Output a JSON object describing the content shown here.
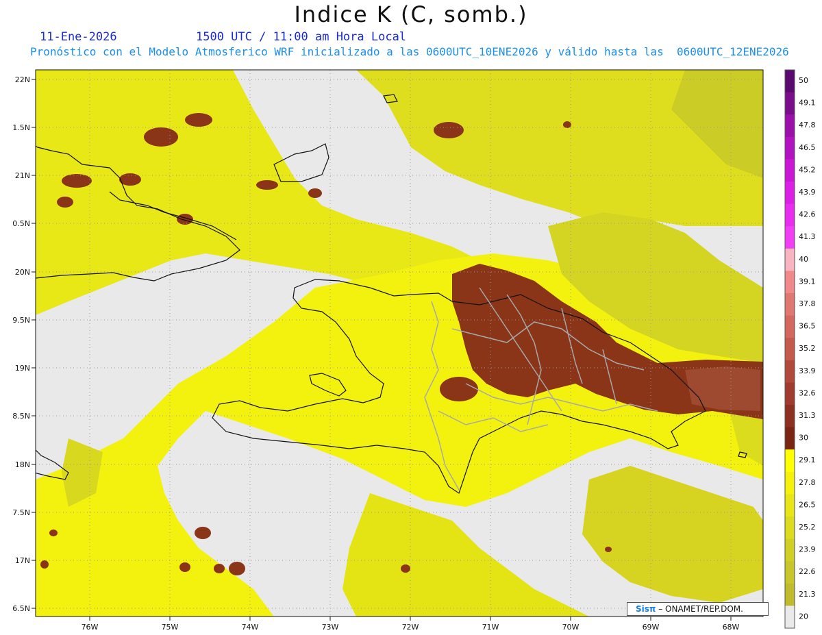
{
  "title": "Indice K (C, somb.)",
  "date": "11-Ene-2026",
  "time_text": "1500 UTC / 11:00 am Hora Local",
  "forecast_text": "Pronóstico con el Modelo Atmosferico WRF inicializado a las 0600UTC_10ENE2026 y válido hasta las  0600UTC_12ENE2026",
  "credit": {
    "logo": "Sisπ",
    "text": "– ONAMET/REP.DOM."
  },
  "lat_labels": [
    "22N",
    "1.5N",
    "21N",
    "0.5N",
    "20N",
    "9.5N",
    "19N",
    "8.5N",
    "18N",
    "7.5N",
    "17N",
    "6.5N"
  ],
  "lon_labels": [
    "76W",
    "75W",
    "74W",
    "73W",
    "72W",
    "71W",
    "70W",
    "69W",
    "68W"
  ],
  "colorbar": {
    "labels": [
      "50",
      "49.1",
      "47.8",
      "46.5",
      "45.2",
      "43.9",
      "42.6",
      "41.3",
      "40",
      "39.1",
      "37.8",
      "36.5",
      "35.2",
      "33.9",
      "32.6",
      "31.3",
      "30",
      "29.1",
      "27.8",
      "26.5",
      "25.2",
      "23.9",
      "22.6",
      "21.3",
      "20"
    ],
    "colors": [
      "#5a0a6e",
      "#7a0d8a",
      "#9a10a8",
      "#b312c0",
      "#cc16d6",
      "#dd1ee6",
      "#e92df0",
      "#f23ef5",
      "#f8b4c0",
      "#f08a8a",
      "#e07872",
      "#d4685e",
      "#c45a4c",
      "#b24a3c",
      "#a03c2e",
      "#8c3020",
      "#7a2414",
      "#ffff00",
      "#f4f20c",
      "#e8e616",
      "#dcdc1e",
      "#d0d024",
      "#c8c62a",
      "#c0bc2e",
      "#eaeaea"
    ]
  }
}
